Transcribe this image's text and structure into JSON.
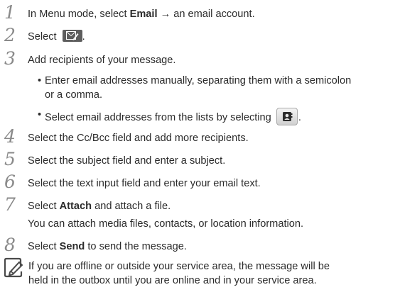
{
  "steps": [
    {
      "number": "1",
      "before": "In Menu mode, select ",
      "bold": "Email",
      "after": " → an email account."
    },
    {
      "number": "2",
      "before": "Select ",
      "icon": "compose-email-icon",
      "after": "."
    },
    {
      "number": "3",
      "text": "Add recipients of your message.",
      "bullets": [
        {
          "line1": "Enter email addresses manually, separating them with a semicolon",
          "line2": "or a comma."
        },
        {
          "before": "Select email addresses from the lists by selecting ",
          "icon": "contacts-icon",
          "after": "."
        }
      ]
    },
    {
      "number": "4",
      "text": "Select the Cc/Bcc field and add more recipients."
    },
    {
      "number": "5",
      "text": "Select the subject field and enter a subject."
    },
    {
      "number": "6",
      "text": "Select the text input field and enter your email text."
    },
    {
      "number": "7",
      "before": "Select ",
      "bold": "Attach",
      "after": " and attach a file.",
      "sub": "You can attach media files, contacts, or location information."
    },
    {
      "number": "8",
      "before": "Select ",
      "bold": "Send",
      "after": " to send the message."
    }
  ],
  "note": {
    "icon": "note-pencil-icon",
    "line1": "If you are offline or outside your service area, the message will be",
    "line2": "held in the outbox until you are online and in your service area."
  },
  "colors": {
    "text": "#2b2b2b",
    "step_number": "#8a8a8a",
    "icon_dark": "#5d5d5d"
  }
}
